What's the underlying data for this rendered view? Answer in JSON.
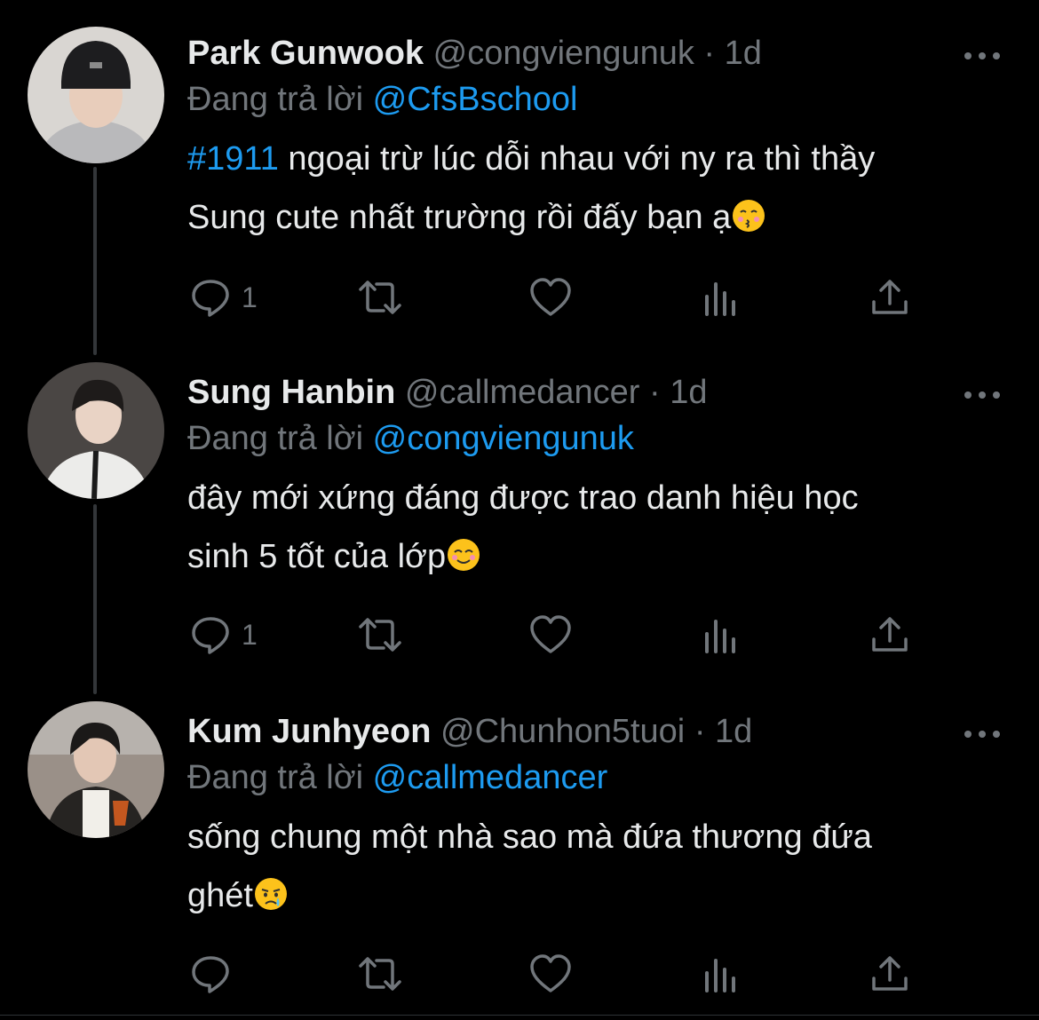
{
  "tweets": [
    {
      "name": "Park Gunwook",
      "handle": "@congviengunuk",
      "separator": "·",
      "time": "1d",
      "replying_label": "Đang trả lời",
      "replying_to": "@CfsBschool",
      "hashtag": "#1911",
      "text_line1": " ngoại trừ lúc dỗi nhau với ny ra thì thầy",
      "text_line2": "Sung cute nhất trường rồi đấy bạn ạ",
      "emoji": "kissing-face-emoji",
      "reply_count": "1"
    },
    {
      "name": "Sung Hanbin",
      "handle": "@callmedancer",
      "separator": "·",
      "time": "1d",
      "replying_label": "Đang trả lời",
      "replying_to": "@congviengunuk",
      "text_line1": "đây mới xứng đáng được trao danh hiệu học",
      "text_line2": "sinh 5 tốt của lớp",
      "emoji": "smiling-face-emoji",
      "reply_count": "1"
    },
    {
      "name": "Kum Junhyeon",
      "handle": "@Chunhon5tuoi",
      "separator": "·",
      "time": "1d",
      "replying_label": "Đang trả lời",
      "replying_to": "@callmedancer",
      "text_line1": "sống chung một nhà sao mà đứa thương đứa",
      "text_line2": "ghét",
      "emoji": "crying-face-emoji",
      "reply_count": ""
    }
  ],
  "icons": {
    "reply": "reply-icon",
    "retweet": "retweet-icon",
    "like": "like-icon",
    "views": "views-icon",
    "share": "share-icon",
    "more": "more-icon"
  },
  "colors": {
    "background": "#000000",
    "text": "#e7e9ea",
    "secondary": "#71767b",
    "accent": "#1d9bf0",
    "thread_line": "#333639"
  }
}
